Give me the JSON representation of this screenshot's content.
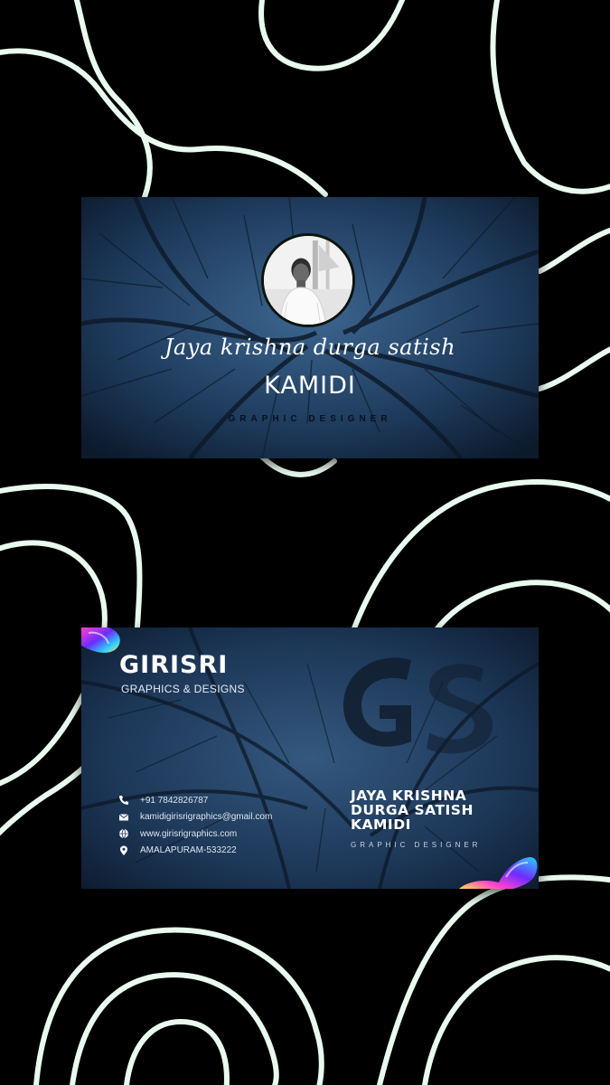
{
  "colors": {
    "background": "#000000",
    "line": "#e8fbee",
    "card_bg": "#1e3a5a",
    "text": "#ffffff"
  },
  "front_card": {
    "name": "Jaya krishna durga satish",
    "surname": "KAMIDI",
    "role": "GRAPHIC DESIGNER"
  },
  "back_card": {
    "brand": "GIRISRI",
    "brand_sub": "GRAPHICS & DESIGNS",
    "name_line1": "JAYA KRISHNA",
    "name_line2": "DURGA SATISH",
    "name_line3": "KAMIDI",
    "role": "GRAPHIC DESIGNER",
    "contacts": [
      {
        "icon": "phone-icon",
        "text": "+91 7842826787"
      },
      {
        "icon": "mail-icon",
        "text": "kamidigirisrigraphics@gmail.com"
      },
      {
        "icon": "globe-icon",
        "text": "www.girisrigraphics.com"
      },
      {
        "icon": "location-pin-icon",
        "text": "AMALAPURAM-533222"
      }
    ]
  }
}
